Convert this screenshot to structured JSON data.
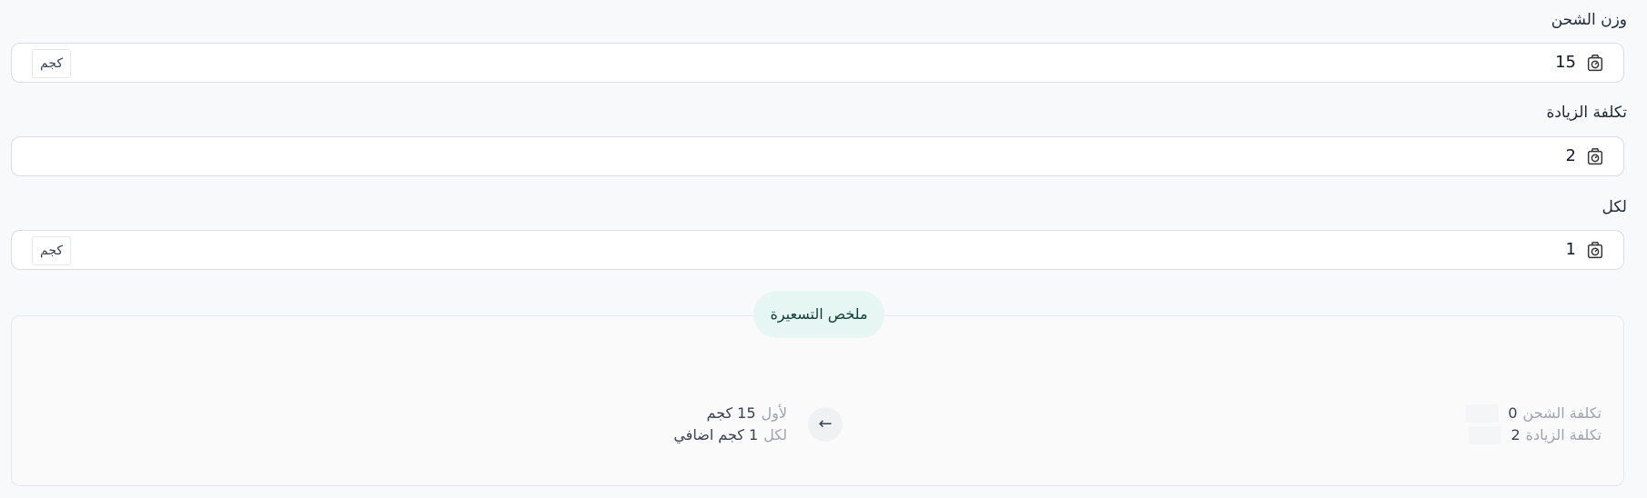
{
  "weight": {
    "label": "وزن الشحن",
    "value": "15",
    "unit": "كجم"
  },
  "increase_cost": {
    "label": "تكلفة الزيادة",
    "value": "2"
  },
  "per": {
    "label": "لكل",
    "value": "1",
    "unit": "كجم"
  },
  "summary": {
    "title": "ملخص التسعيرة",
    "shipping_cost_label": "تكلفة الشحن",
    "shipping_cost_value": "0",
    "increase_cost_label": "تكلفة الزيادة",
    "increase_cost_value": "2",
    "first_prefix": "لأول",
    "first_value": "15 كجم",
    "per_prefix": "لكل",
    "per_value": "1 كجم اضافي",
    "arrow_icon": "arrow-left-icon"
  }
}
